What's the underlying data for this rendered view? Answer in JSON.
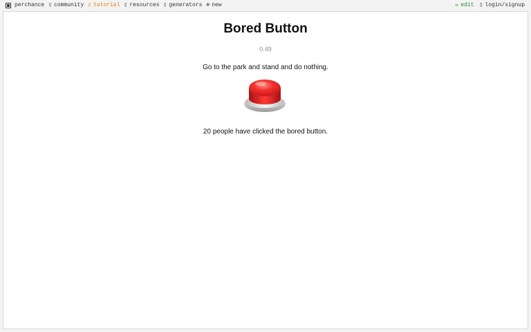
{
  "nav": {
    "left": [
      {
        "label": "perchance",
        "icon": "dice-icon"
      },
      {
        "label": "community",
        "icon": "community-icon"
      },
      {
        "label": "tutorial",
        "icon": "tutorial-icon"
      },
      {
        "label": "resources",
        "icon": "resources-icon"
      },
      {
        "label": "generators",
        "icon": "generators-icon"
      },
      {
        "label": "new",
        "icon": "plus-circle-icon"
      }
    ],
    "right": [
      {
        "label": "edit",
        "icon": "pencil-icon"
      },
      {
        "label": "login/signup",
        "icon": "user-icon"
      }
    ]
  },
  "page": {
    "title": "Bored Button",
    "value": "0.49",
    "activity": "Go to the park and stand and do nothing.",
    "button_icon": "red-button-icon",
    "count_text": "20 people have clicked the bored button."
  },
  "colors": {
    "accent_tutorial": "#e07b1a",
    "accent_edit": "#2a8a2a",
    "button_red": "#e8262a"
  }
}
